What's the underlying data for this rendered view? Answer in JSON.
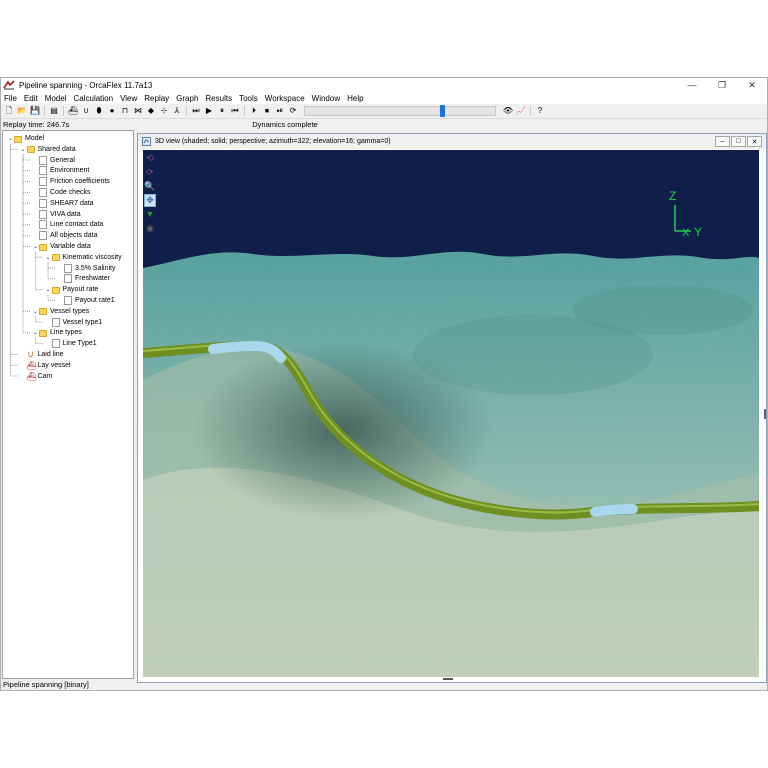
{
  "window": {
    "title": "Pipeline spanning - OrcaFlex 11.7a13",
    "app_icon": "orcaflex-icon",
    "minimize_glyph": "—",
    "maximize_glyph": "❐",
    "close_glyph": "✕"
  },
  "menu": [
    "File",
    "Edit",
    "Model",
    "Calculation",
    "View",
    "Replay",
    "Graph",
    "Results",
    "Tools",
    "Workspace",
    "Window",
    "Help"
  ],
  "toolbar": {
    "buttons": [
      {
        "name": "new-icon",
        "glyph": "🗋"
      },
      {
        "name": "open-icon",
        "glyph": "📂"
      },
      {
        "name": "save-icon",
        "glyph": "💾"
      },
      {
        "name": "model-browser-icon",
        "glyph": "▤"
      },
      {
        "name": "new-vessel-icon",
        "glyph": "⛴"
      },
      {
        "name": "new-line-icon",
        "glyph": "∪"
      },
      {
        "name": "new-6d-buoy-icon",
        "glyph": "⬮"
      },
      {
        "name": "new-3d-buoy-icon",
        "glyph": "●"
      },
      {
        "name": "new-winch-icon",
        "glyph": "⊓"
      },
      {
        "name": "new-link-icon",
        "glyph": "⋈"
      },
      {
        "name": "new-shape-icon",
        "glyph": "◆"
      },
      {
        "name": "new-constraint-icon",
        "glyph": "⊹"
      },
      {
        "name": "new-turbine-icon",
        "glyph": "⅄"
      },
      {
        "name": "static-icon",
        "glyph": "⏭"
      },
      {
        "name": "run-icon",
        "glyph": "▶"
      },
      {
        "name": "pause-icon",
        "glyph": "⏸"
      },
      {
        "name": "reset-icon",
        "glyph": "⏮"
      },
      {
        "name": "start-replay-icon",
        "glyph": "⏵"
      },
      {
        "name": "stop-replay-icon",
        "glyph": "⏹"
      },
      {
        "name": "replay-step-icon",
        "glyph": "⏯"
      },
      {
        "name": "replay-parameters-icon",
        "glyph": "⟳"
      },
      {
        "name": "view-icon",
        "glyph": "👁"
      },
      {
        "name": "results-icon",
        "glyph": "📈"
      },
      {
        "name": "help-icon",
        "glyph": "?"
      }
    ],
    "replay_progress_fraction": 0.72
  },
  "status_strip": {
    "replay_time": "Replay time: 246.7s",
    "dynamics": "Dynamics complete"
  },
  "tree": [
    {
      "label": "Model",
      "depth": 0,
      "icon": "folder",
      "expanded": true
    },
    {
      "label": "Shared data",
      "depth": 1,
      "icon": "folder",
      "expanded": true
    },
    {
      "label": "General",
      "depth": 2,
      "icon": "doc"
    },
    {
      "label": "Environment",
      "depth": 2,
      "icon": "doc"
    },
    {
      "label": "Friction coefficients",
      "depth": 2,
      "icon": "doc"
    },
    {
      "label": "Code checks",
      "depth": 2,
      "icon": "doc"
    },
    {
      "label": "SHEAR7 data",
      "depth": 2,
      "icon": "doc"
    },
    {
      "label": "VIVA data",
      "depth": 2,
      "icon": "doc"
    },
    {
      "label": "Line contact data",
      "depth": 2,
      "icon": "doc"
    },
    {
      "label": "All objects data",
      "depth": 2,
      "icon": "doc"
    },
    {
      "label": "Variable data",
      "depth": 2,
      "icon": "folder",
      "expanded": true
    },
    {
      "label": "Kinematic viscosity",
      "depth": 3,
      "icon": "folder",
      "expanded": true
    },
    {
      "label": "3.5% Salinity",
      "depth": 4,
      "icon": "doc"
    },
    {
      "label": "Freshwater",
      "depth": 4,
      "icon": "doc"
    },
    {
      "label": "Payout rate",
      "depth": 3,
      "icon": "folder",
      "expanded": true
    },
    {
      "label": "Payout rate1",
      "depth": 4,
      "icon": "doc"
    },
    {
      "label": "Vessel types",
      "depth": 2,
      "icon": "folder",
      "expanded": true
    },
    {
      "label": "Vessel type1",
      "depth": 3,
      "icon": "doc"
    },
    {
      "label": "Line types",
      "depth": 2,
      "icon": "folder",
      "expanded": true
    },
    {
      "label": "Line Type1",
      "depth": 3,
      "icon": "doc"
    },
    {
      "label": "Laid line",
      "depth": 1,
      "icon": "line"
    },
    {
      "label": "Lay vessel",
      "depth": 1,
      "icon": "vessel"
    },
    {
      "label": "Cam",
      "depth": 1,
      "icon": "vessel"
    }
  ],
  "view": {
    "title": "3D view (shaded; solid; perspective; azimuth=322; elevation=16; gamma=0)",
    "axis_z": "Z",
    "axis_y": "Y",
    "axis_x": "X",
    "tools": [
      {
        "name": "rotate-icon",
        "glyph": "⟲"
      },
      {
        "name": "orbit-icon",
        "glyph": "⟳"
      },
      {
        "name": "zoom-icon",
        "glyph": "🔍"
      },
      {
        "name": "pan-icon",
        "glyph": "✥"
      },
      {
        "name": "shading-icon",
        "glyph": "▼"
      },
      {
        "name": "visibility-icon",
        "glyph": "◉"
      }
    ],
    "colors": {
      "sky": "#0f1f4a",
      "seabed_far": "#4e9c9a",
      "seabed_near": "#b9cbb7",
      "pipe": "#6f8f22",
      "pipe_highlight": "#9dc13c",
      "buoyancy": "#a9d8ee",
      "axis": "#22d04a"
    }
  },
  "statusbar": {
    "text": "Pipeline spanning [binary]"
  }
}
